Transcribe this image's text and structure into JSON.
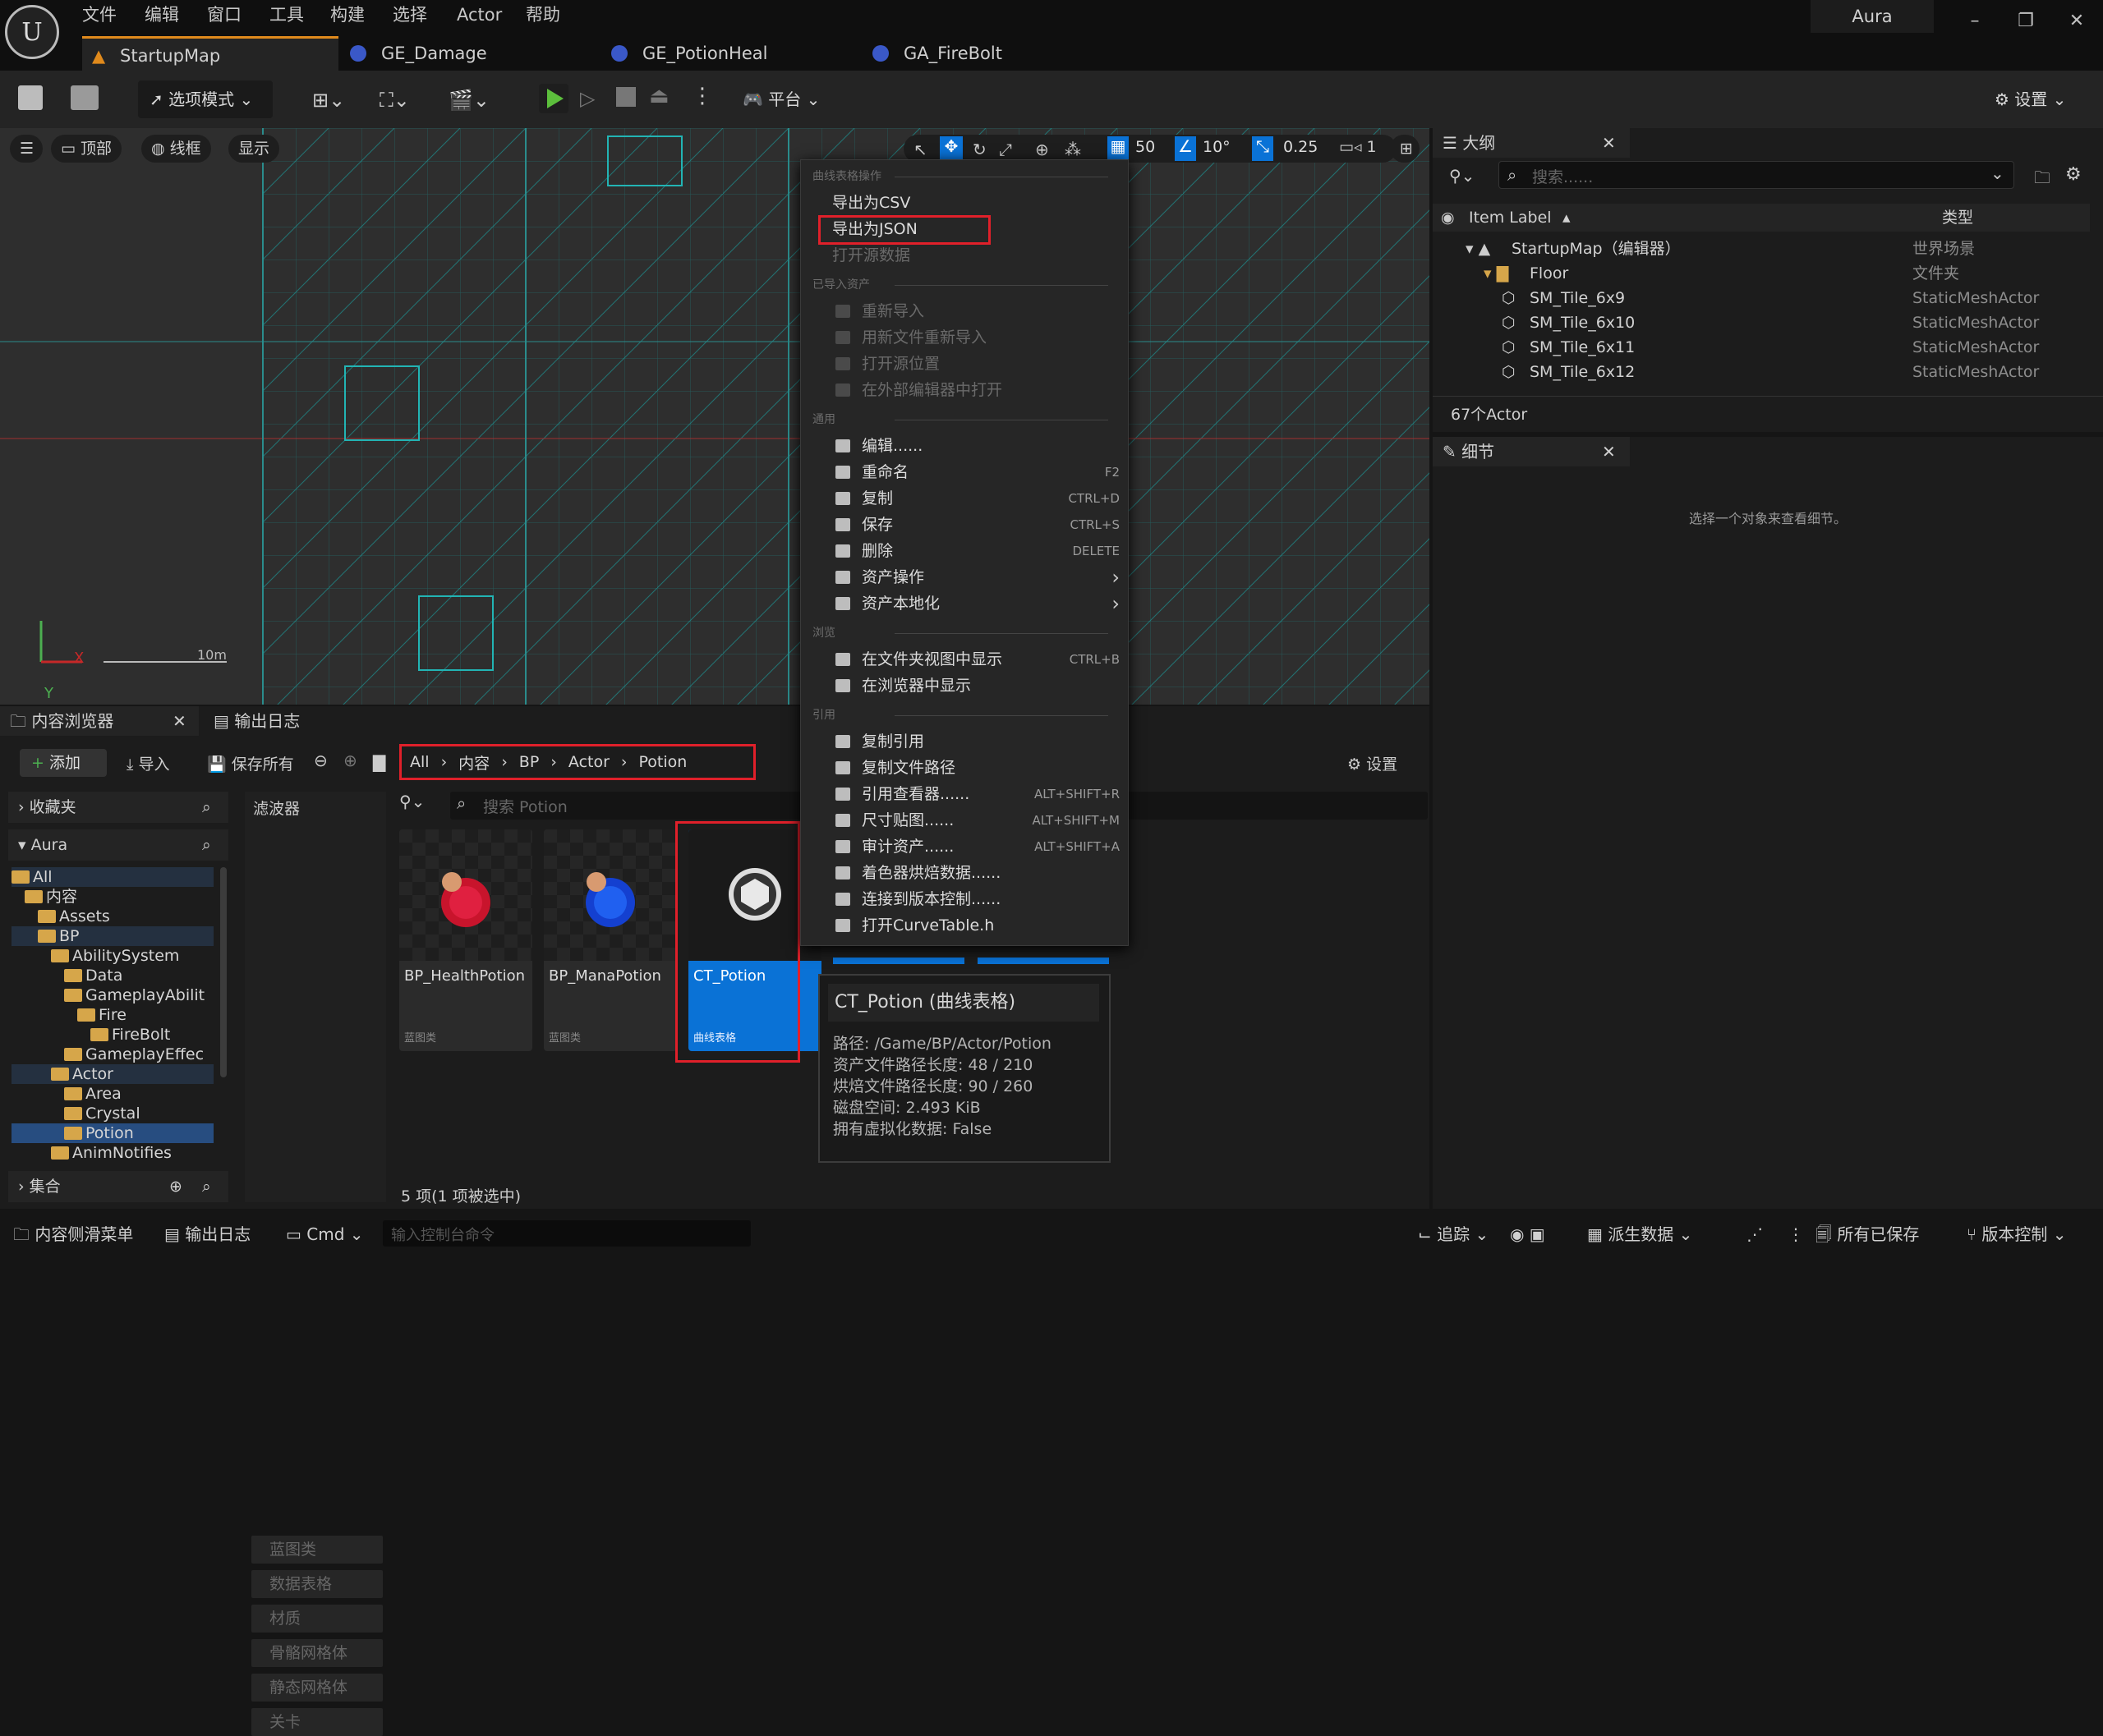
{
  "app": {
    "menu": [
      "文件",
      "编辑",
      "窗口",
      "工具",
      "构建",
      "选择",
      "Actor",
      "帮助"
    ],
    "project": "Aura",
    "tabs": [
      "StartupMap",
      "GE_Damage",
      "GE_PotionHeal",
      "GA_FireBolt"
    ]
  },
  "toolbar": {
    "mode_label": "选项模式",
    "platform_label": "平台",
    "settings_label": "设置"
  },
  "viewport": {
    "view_label": "顶部",
    "wireframe_label": "线框",
    "show_label": "显示",
    "grid_snap": "50",
    "rot_snap": "10°",
    "scale_snap": "0.25",
    "camera_speed": "1",
    "scale_text": "10m",
    "axis_x": "X",
    "axis_y": "Y"
  },
  "context_menu": {
    "sections": {
      "curve": "曲线表格操作",
      "imported": "已导入资产",
      "common": "通用",
      "browse": "浏览",
      "refs": "引用"
    },
    "curve_items": [
      {
        "label": "导出为CSV",
        "enabled": true
      },
      {
        "label": "导出为JSON",
        "enabled": true,
        "highlighted": true
      },
      {
        "label": "打开源数据",
        "enabled": false
      }
    ],
    "imported_items": [
      {
        "label": "重新导入",
        "icon": "reimport-icon"
      },
      {
        "label": "用新文件重新导入",
        "icon": "reimport-new-icon"
      },
      {
        "label": "打开源位置",
        "icon": "open-location-icon"
      },
      {
        "label": "在外部编辑器中打开",
        "icon": "external-editor-icon"
      }
    ],
    "common_items": [
      {
        "label": "编辑......",
        "shortcut": "",
        "icon": "edit-icon"
      },
      {
        "label": "重命名",
        "shortcut": "F2",
        "icon": "rename-icon"
      },
      {
        "label": "复制",
        "shortcut": "CTRL+D",
        "icon": "duplicate-icon"
      },
      {
        "label": "保存",
        "shortcut": "CTRL+S",
        "icon": "save-icon"
      },
      {
        "label": "删除",
        "shortcut": "DELETE",
        "icon": "delete-icon"
      },
      {
        "label": "资产操作",
        "shortcut": "",
        "icon": "asset-actions-icon",
        "submenu": true
      },
      {
        "label": "资产本地化",
        "shortcut": "",
        "icon": "localization-icon",
        "submenu": true
      }
    ],
    "browse_items": [
      {
        "label": "在文件夹视图中显示",
        "shortcut": "CTRL+B",
        "icon": "folder-view-icon"
      },
      {
        "label": "在浏览器中显示",
        "shortcut": "",
        "icon": "explorer-icon"
      }
    ],
    "refs_items": [
      {
        "label": "复制引用",
        "shortcut": "",
        "icon": "copy-ref-icon"
      },
      {
        "label": "复制文件路径",
        "shortcut": "",
        "icon": "copy-path-icon"
      },
      {
        "label": "引用查看器......",
        "shortcut": "ALT+SHIFT+R",
        "icon": "ref-viewer-icon"
      },
      {
        "label": "尺寸贴图......",
        "shortcut": "ALT+SHIFT+M",
        "icon": "size-map-icon"
      },
      {
        "label": "审计资产......",
        "shortcut": "ALT+SHIFT+A",
        "icon": "audit-icon"
      },
      {
        "label": "着色器烘焙数据......",
        "shortcut": "",
        "icon": "shader-icon"
      },
      {
        "label": "连接到版本控制......",
        "shortcut": "",
        "icon": "source-control-icon"
      },
      {
        "label": "打开CurveTable.h",
        "shortcut": "",
        "icon": "header-file-icon"
      }
    ]
  },
  "outliner": {
    "tab": "大纲",
    "search_placeholder": "搜索......",
    "col_label": "Item Label",
    "col_type": "类型",
    "rows": [
      {
        "label": "StartupMap（编辑器）",
        "type": "世界场景",
        "indent": 0
      },
      {
        "label": "Floor",
        "type": "文件夹",
        "indent": 1
      },
      {
        "label": "SM_Tile_6x9",
        "type": "StaticMeshActor",
        "indent": 2
      },
      {
        "label": "SM_Tile_6x10",
        "type": "StaticMeshActor",
        "indent": 2
      },
      {
        "label": "SM_Tile_6x11",
        "type": "StaticMeshActor",
        "indent": 2
      },
      {
        "label": "SM_Tile_6x12",
        "type": "StaticMeshActor",
        "indent": 2
      }
    ],
    "count": "67个Actor"
  },
  "details": {
    "tab": "细节",
    "empty_text": "选择一个对象来查看细节。"
  },
  "content_browser": {
    "tab": "内容浏览器",
    "log_tab": "输出日志",
    "add_label": "添加",
    "import_label": "导入",
    "save_all_label": "保存所有",
    "breadcrumb": [
      "All",
      "内容",
      "BP",
      "Actor",
      "Potion"
    ],
    "settings_label": "设置",
    "favorites_label": "收藏夹",
    "project_label": "Aura",
    "filters_label": "滤波器",
    "search_placeholder": "搜索 Potion",
    "filters": [
      "蓝图类",
      "数据表格",
      "材质",
      "骨骼网格体",
      "静态网格体",
      "关卡"
    ],
    "tree": [
      {
        "label": "All",
        "indent": 0
      },
      {
        "label": "内容",
        "indent": 1
      },
      {
        "label": "Assets",
        "indent": 2
      },
      {
        "label": "BP",
        "indent": 2
      },
      {
        "label": "AbilitySystem",
        "indent": 3
      },
      {
        "label": "Data",
        "indent": 4
      },
      {
        "label": "GameplayAbilit",
        "indent": 4
      },
      {
        "label": "Fire",
        "indent": 5
      },
      {
        "label": "FireBolt",
        "indent": 6
      },
      {
        "label": "GameplayEffec",
        "indent": 4
      },
      {
        "label": "Actor",
        "indent": 3
      },
      {
        "label": "Area",
        "indent": 4
      },
      {
        "label": "Crystal",
        "indent": 4
      },
      {
        "label": "Potion",
        "indent": 4
      },
      {
        "label": "AnimNotifies",
        "indent": 3
      }
    ],
    "collections_label": "集合",
    "assets": [
      {
        "name": "BP_HealthPotion",
        "type": "蓝图类"
      },
      {
        "name": "BP_ManaPotion",
        "type": "蓝图类"
      },
      {
        "name": "CT_Potion",
        "type": "曲线表格"
      }
    ],
    "status": "5 项(1 项被选中)"
  },
  "tooltip": {
    "title": "CT_Potion (曲线表格)",
    "lines": [
      "路径: /Game/BP/Actor/Potion",
      "资产文件路径长度: 48 / 210",
      "烘焙文件路径长度: 90 / 260",
      "磁盘空间: 2.493 KiB",
      "拥有虚拟化数据: False"
    ]
  },
  "statusbar": {
    "drawer": "内容侧滑菜单",
    "output_log": "输出日志",
    "cmd": "Cmd",
    "console_placeholder": "输入控制台命令",
    "trace": "追踪",
    "derived_data": "派生数据",
    "all_saved": "所有已保存",
    "source_control": "版本控制"
  },
  "colors": {
    "accent": "#e0202a",
    "selection": "#0a72d6",
    "grid": "#1aa0a0"
  }
}
